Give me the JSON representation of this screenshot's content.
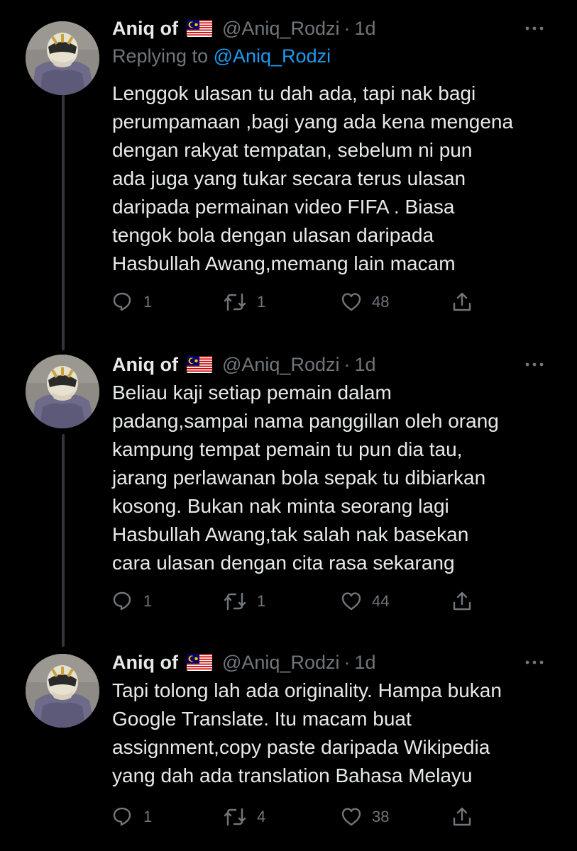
{
  "theme": {
    "background": "#000000",
    "text_primary": "#e7e9ea",
    "text_secondary": "#71767b",
    "link": "#1d9bf0",
    "thread_line": "#333639"
  },
  "icons": {
    "reply": "comment-bubble-icon",
    "retweet": "retweet-arrows-icon",
    "like": "heart-icon",
    "share": "share-upload-icon",
    "more": "more-dots-icon",
    "flag": "malaysia-flag-icon"
  },
  "tweets": [
    {
      "author_name": "Aniq of",
      "handle": "@Aniq_Rodzi",
      "dot": "·",
      "time": "1d",
      "replying_prefix": "Replying to ",
      "replying_handle": "@Aniq_Rodzi",
      "text": "Lenggok ulasan tu dah ada, tapi nak bagi\nperumpamaan ,bagi yang ada kena mengena\ndengan rakyat tempatan, sebelum ni pun\nada juga yang tukar secara terus ulasan\ndaripada permainan video FIFA . Biasa\ntengok bola dengan ulasan daripada\nHasbullah Awang,memang lain macam",
      "replies": "1",
      "retweets": "1",
      "likes": "48"
    },
    {
      "author_name": "Aniq of",
      "handle": "@Aniq_Rodzi",
      "dot": "·",
      "time": "1d",
      "text": "Beliau kaji setiap pemain dalam\npadang,sampai nama panggillan oleh orang\nkampung tempat pemain tu pun dia tau,\njarang perlawanan bola sepak tu dibiarkan\nkosong. Bukan nak minta seorang lagi\nHasbullah Awang,tak salah nak basekan\ncara ulasan dengan cita rasa sekarang",
      "replies": "1",
      "retweets": "1",
      "likes": "44"
    },
    {
      "author_name": "Aniq of",
      "handle": "@Aniq_Rodzi",
      "dot": "·",
      "time": "1d",
      "text": "Tapi tolong lah ada originality. Hampa bukan\nGoogle Translate. Itu macam buat\nassignment,copy paste daripada Wikipedia\nyang dah ada translation Bahasa Melayu",
      "replies": "1",
      "retweets": "4",
      "likes": "38"
    }
  ]
}
